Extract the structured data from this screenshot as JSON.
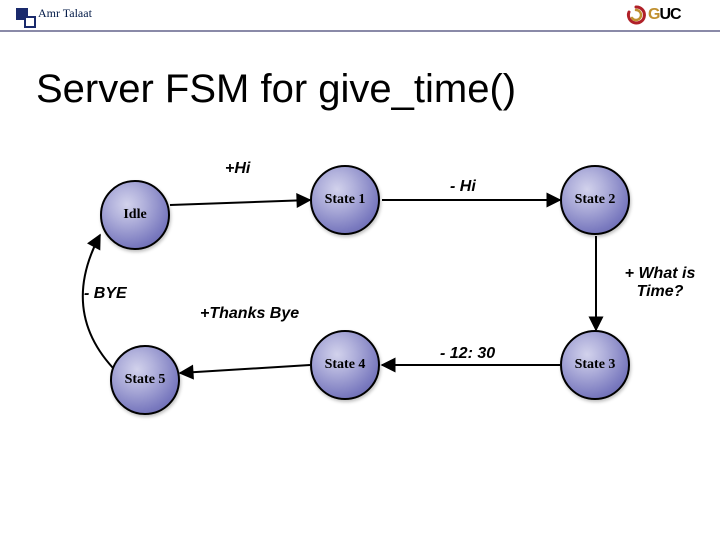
{
  "author": "Amr Talaat",
  "logo": {
    "text_pre": "G",
    "text_post": "UC"
  },
  "title": "Server FSM for give_time()",
  "states": {
    "idle": "Idle",
    "s1": "State 1",
    "s2": "State 2",
    "s3": "State 3",
    "s4": "State 4",
    "s5": "State 5"
  },
  "edges": {
    "idle_s1": "+Hi",
    "s1_s2": "- Hi",
    "s2_s3": "+ What is Time?",
    "s3_s4": "- 12: 30",
    "s4_s5": "+Thanks Bye",
    "s5_idle": "- BYE"
  },
  "chart_data": {
    "type": "fsm",
    "nodes": [
      "Idle",
      "State 1",
      "State 2",
      "State 3",
      "State 4",
      "State 5"
    ],
    "transitions": [
      {
        "from": "Idle",
        "to": "State 1",
        "label": "+Hi"
      },
      {
        "from": "State 1",
        "to": "State 2",
        "label": "- Hi"
      },
      {
        "from": "State 2",
        "to": "State 3",
        "label": "+ What is Time?"
      },
      {
        "from": "State 3",
        "to": "State 4",
        "label": "- 12: 30"
      },
      {
        "from": "State 4",
        "to": "State 5",
        "label": "+Thanks Bye"
      },
      {
        "from": "State 5",
        "to": "Idle",
        "label": "- BYE"
      }
    ]
  }
}
